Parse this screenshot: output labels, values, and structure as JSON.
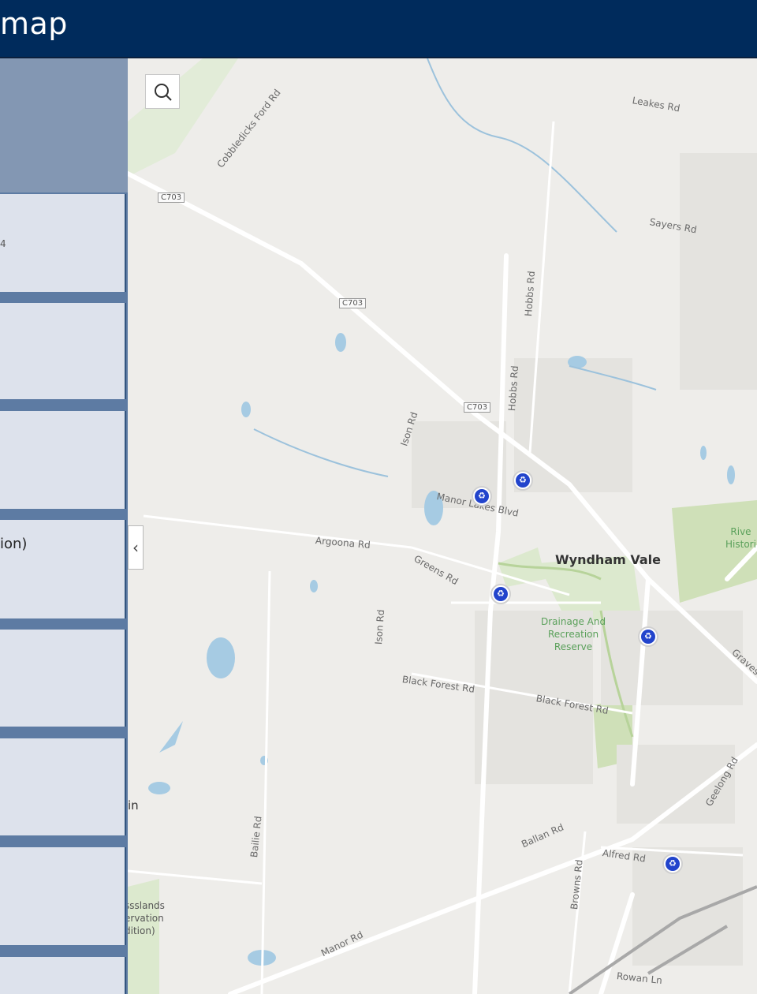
{
  "header": {
    "title": "map"
  },
  "sidebar": {
    "panels": [
      {
        "big": "",
        "small": "4"
      },
      {
        "big": "",
        "small": ""
      },
      {
        "big": "",
        "small": ""
      },
      {
        "big": "ion)",
        "small": ""
      },
      {
        "big": "",
        "small": ""
      },
      {
        "big": "",
        "small": ""
      },
      {
        "big": "",
        "small": ""
      },
      {
        "big": "",
        "small": ""
      }
    ]
  },
  "map": {
    "search_icon": "search-icon",
    "collapse_icon": "chevron-left-icon",
    "collapse_glyph": "‹",
    "marker_icon": "recycle-icon",
    "marker_glyph": "♻",
    "colors": {
      "header": "#002b5c",
      "sidebar": "#5d7ba3",
      "marker": "#2244cc",
      "park": "#cfe0b8",
      "water": "#a6cbe3"
    },
    "labels": {
      "leakes": "Leakes Rd",
      "cobbledicks": "Cobbledicks Ford Rd",
      "c703_a": "C703",
      "c703_b": "C703",
      "c703_c": "C703",
      "sayers": "Sayers Rd",
      "hobbs_a": "Hobbs Rd",
      "hobbs_b": "Hobbs Rd",
      "ison_a": "Ison Rd",
      "ison_b": "Ison Rd",
      "manor_blvd": "Manor Lakes Blvd",
      "argoona": "Argoona Rd",
      "greens": "Greens Rd",
      "wyndham": "Wyndham Vale",
      "drainage": "Drainage And\nRecreation\nReserve",
      "river": "Rive\nHistori",
      "graves": "Graves",
      "black_forest_a": "Black Forest Rd",
      "black_forest_b": "Black Forest Rd",
      "geelong": "Geelong Rd",
      "ballan": "Ballan Rd",
      "alfred": "Alfred Rd",
      "browns": "Browns Rd",
      "baileys": "Bailie Rd",
      "manor_rd": "Manor Rd",
      "rowan": "Rowan Ln",
      "grasslands": "ssslands\nervation\ndition)",
      "in": "in"
    }
  }
}
